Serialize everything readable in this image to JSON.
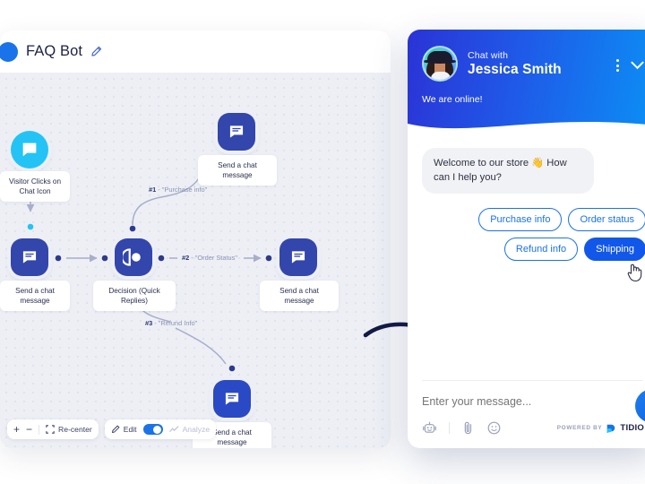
{
  "builder": {
    "title": "FAQ Bot",
    "edit_icon": "pencil-icon",
    "nodes": [
      {
        "id": "trigger",
        "label": "Visitor Clicks on\nChat Icon",
        "icon": "chat-bubble-icon",
        "style": "cyan-round"
      },
      {
        "id": "send-1",
        "label": "Send a chat\nmessage",
        "icon": "chat-message-icon",
        "style": "navy"
      },
      {
        "id": "decision",
        "label": "Decision (Quick\nReplies)",
        "icon": "decision-icon",
        "style": "navy"
      },
      {
        "id": "send-top",
        "label": "Send a chat\nmessage",
        "icon": "chat-message-icon",
        "style": "navy"
      },
      {
        "id": "send-right",
        "label": "Send a chat\nmessage",
        "icon": "chat-message-icon",
        "style": "navy"
      },
      {
        "id": "send-bottom",
        "label": "Send a chat\nmessage",
        "icon": "chat-message-icon",
        "style": "bright"
      }
    ],
    "connectors": [
      {
        "num": "#1",
        "text": " - \"Purchase info\""
      },
      {
        "num": "#2",
        "text": " - \"Order Status\""
      },
      {
        "num": "#3",
        "text": " - \"Refund Info\""
      }
    ],
    "toolbar": {
      "zoom_in": "+",
      "zoom_out": "−",
      "recenter": "Re-center",
      "edit": "Edit",
      "analyze": "Analyze",
      "edit_toggle_on": true
    }
  },
  "widget": {
    "chat_with": "Chat with",
    "agent_name": "Jessica Smith",
    "status": "We are online!",
    "message": "Welcome to our store 👋\nHow can I help you?",
    "quick_replies": [
      {
        "label": "Purchase info",
        "selected": false
      },
      {
        "label": "Order status",
        "selected": false
      },
      {
        "label": "Refund info",
        "selected": false
      },
      {
        "label": "Shipping",
        "selected": true
      }
    ],
    "input_placeholder": "Enter your message...",
    "footer_icons": [
      "bot-icon",
      "attachment-icon",
      "emoji-icon"
    ],
    "powered_by": "POWERED BY",
    "brand": "TIDIO"
  },
  "colors": {
    "accent_blue": "#1a73e8",
    "node_navy": "#3246ab",
    "trigger_cyan": "#23c4f5",
    "canvas": "#edeff5",
    "selected_reply": "#1158ea"
  }
}
